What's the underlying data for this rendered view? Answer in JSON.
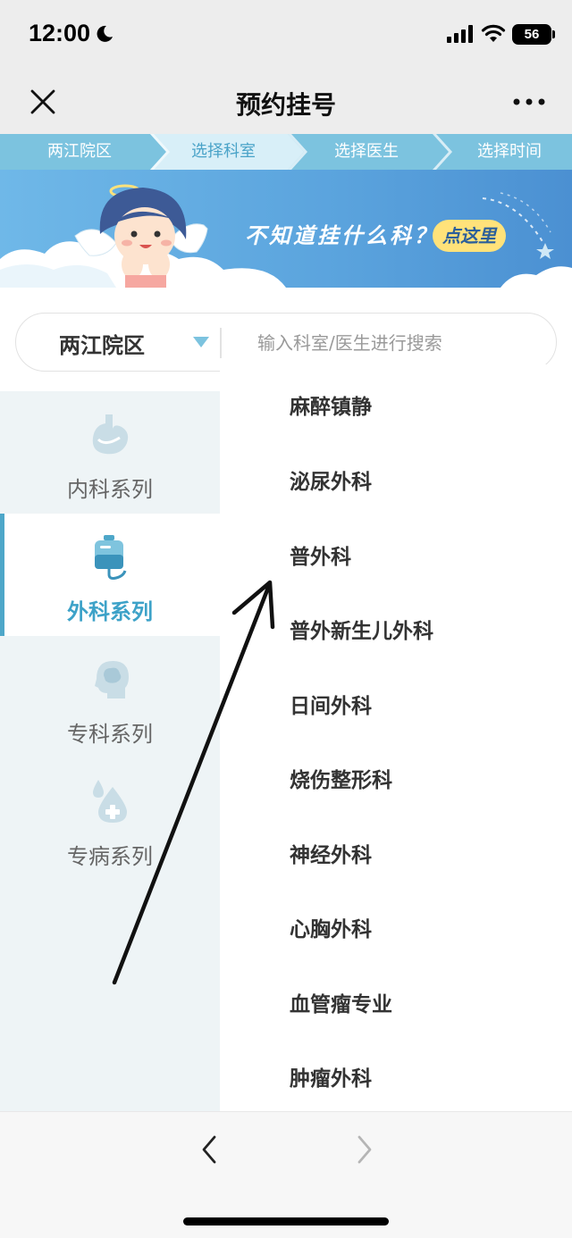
{
  "status_bar": {
    "time": "12:00",
    "battery": "56"
  },
  "nav": {
    "title": "预约挂号"
  },
  "steps": [
    "两江院区",
    "选择科室",
    "选择医生",
    "选择时间"
  ],
  "banner": {
    "text": "不知道挂什么科？",
    "button": "点这里"
  },
  "search": {
    "campus": "两江院区",
    "placeholder": "输入科室/医生进行搜索"
  },
  "categories": [
    {
      "label": "内科系列",
      "icon": "stomach-icon",
      "active": false
    },
    {
      "label": "外科系列",
      "icon": "iv-drip-icon",
      "active": true
    },
    {
      "label": "专科系列",
      "icon": "head-brain-icon",
      "active": false
    },
    {
      "label": "专病系列",
      "icon": "droplet-plus-icon",
      "active": false
    }
  ],
  "departments": [
    "麻醉镇静",
    "泌尿外科",
    "普外科",
    "普外新生儿外科",
    "日间外科",
    "烧伤整形科",
    "神经外科",
    "心胸外科",
    "血管瘤专业",
    "肿瘤外科"
  ],
  "colors": {
    "accent": "#3da2c8",
    "step_bar": "#7cc3df",
    "banner_button": "#ffe27a"
  }
}
